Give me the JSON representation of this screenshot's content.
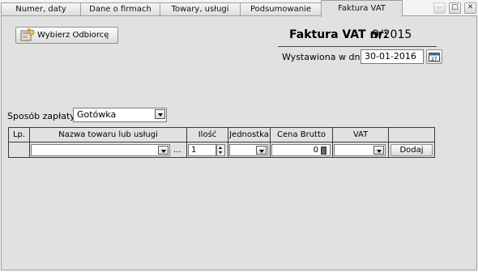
{
  "tabs": [
    {
      "label": "Numer, daty"
    },
    {
      "label": "Dane o firmach"
    },
    {
      "label": "Towary, usługi"
    },
    {
      "label": "Podsumowanie"
    },
    {
      "label": "Faktura VAT"
    }
  ],
  "active_tab": "Faktura VAT",
  "select_recipient_button": {
    "label": "Wybierz Odbiorcę",
    "icon": "contact-book-icon"
  },
  "invoice": {
    "title": "Faktura VAT nr:",
    "number": "9/2015",
    "issue_date_label": "Wystawiona w dniu:",
    "issue_date": "30-01-2016"
  },
  "payment": {
    "label": "Sposób zapłaty:",
    "value": "Gotówka"
  },
  "table": {
    "headers": [
      "Lp.",
      "Nazwa towaru lub usługi",
      "Ilość",
      "Jednostka",
      "Cena Brutto",
      "VAT",
      ""
    ],
    "row": {
      "name": "",
      "more": "...",
      "quantity": "1",
      "unit": "",
      "price": "0",
      "vat": "",
      "add_label": "Dodaj"
    }
  },
  "window_controls": [
    "minimize",
    "maximize",
    "close"
  ],
  "colors": {
    "panel": "#e1e1e1",
    "border": "#3a3a3a"
  }
}
